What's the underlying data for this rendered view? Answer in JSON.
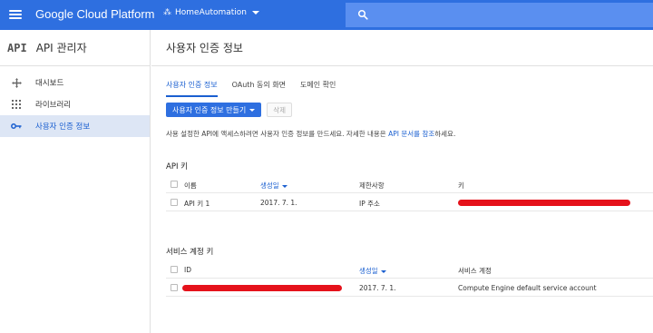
{
  "topbar": {
    "brand": "Google Cloud Platform",
    "project": "HomeAutomation",
    "accent": "#2e6fe0"
  },
  "sidebar": {
    "logo": "API",
    "title": "API 관리자",
    "items": [
      {
        "label": "대시보드",
        "icon": "dashboard-icon"
      },
      {
        "label": "라이브러리",
        "icon": "library-icon"
      },
      {
        "label": "사용자 인증 정보",
        "icon": "key-icon",
        "active": true
      }
    ]
  },
  "main": {
    "title": "사용자 인증 정보",
    "tabs": [
      "사용자 인증 정보",
      "OAuth 동의 화면",
      "도메인 확인"
    ],
    "create_button": "사용자 인증 정보 만들기",
    "delete_button": "삭제",
    "description_prefix": "사용 설정한 API에 액세스하려면 사용자 인증 정보를 만드세요. 자세한 내용은",
    "description_link": "API 문서를 참조",
    "description_suffix": "하세요."
  },
  "api_keys": {
    "title": "API 키",
    "columns": [
      "이름",
      "생성일",
      "제한사항",
      "키"
    ],
    "rows": [
      {
        "name": "API 키 1",
        "created": "2017. 7. 1.",
        "restriction": "IP 주소",
        "key_redacted": true
      }
    ]
  },
  "service_accounts": {
    "title": "서비스 계정 키",
    "columns": [
      "ID",
      "생성일",
      "서비스 계정"
    ],
    "rows": [
      {
        "id_redacted": true,
        "created": "2017. 7. 1.",
        "account": "Compute Engine default service account"
      }
    ]
  }
}
